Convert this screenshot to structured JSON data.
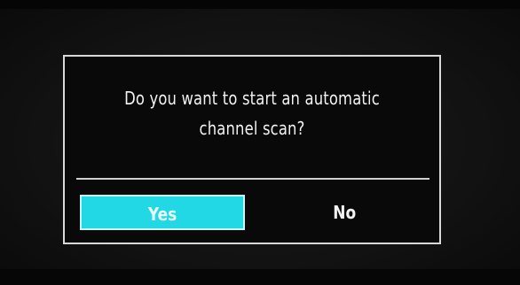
{
  "dialog": {
    "message_line1": "Do you want to start an automatic",
    "message_line2": "channel scan?",
    "buttons": {
      "yes_label": "Yes",
      "no_label": "No",
      "selected": "Yes"
    }
  },
  "colors": {
    "highlight": "#22d8e4",
    "border": "#d8d8d8",
    "background": "#090909",
    "text": "#f2f2f2"
  }
}
